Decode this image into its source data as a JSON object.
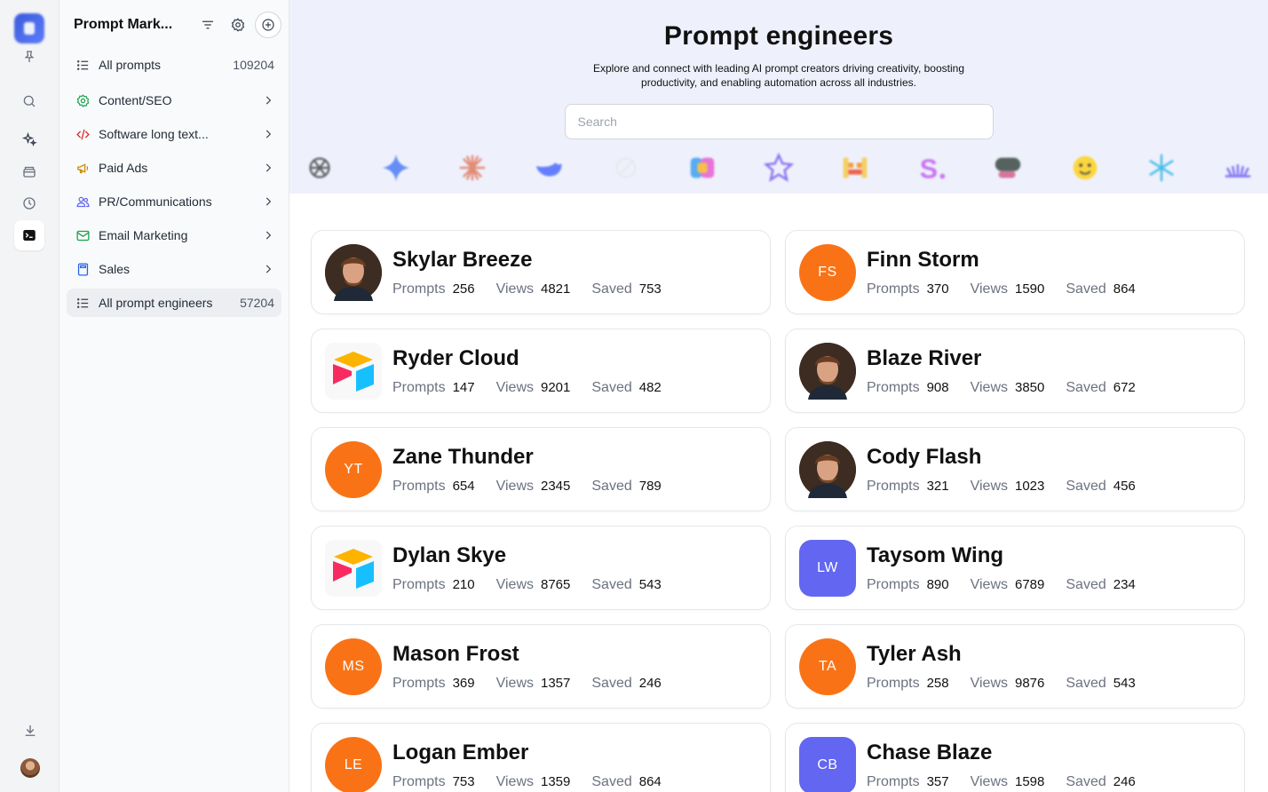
{
  "app": {
    "title": "Prompt Mark..."
  },
  "rail": {
    "icons": [
      "app-logo",
      "pin-icon",
      "search-icon",
      "sparkles-icon",
      "archive-icon",
      "history-icon",
      "terminal-icon",
      "download-icon",
      "user-avatar"
    ]
  },
  "sidebar": {
    "items": [
      {
        "label": "All prompts",
        "count": "109204",
        "icon": "list-icon"
      },
      {
        "label": "Content/SEO",
        "icon": "gear-icon"
      },
      {
        "label": "Software long text...",
        "icon": "code-icon"
      },
      {
        "label": "Paid Ads",
        "icon": "megaphone-icon"
      },
      {
        "label": "PR/Communications",
        "icon": "users-icon"
      },
      {
        "label": "Email Marketing",
        "icon": "mail-icon"
      },
      {
        "label": "Sales",
        "icon": "calculator-icon"
      },
      {
        "label": "All prompt engineers",
        "count": "57204",
        "icon": "list-icon"
      }
    ]
  },
  "hero": {
    "title": "Prompt engineers",
    "subtitle": "Explore and connect with leading AI prompt creators driving creativity, boosting productivity, and enabling automation across all industries.",
    "search_placeholder": "Search"
  },
  "stat_labels": {
    "prompts": "Prompts",
    "views": "Views",
    "saved": "Saved"
  },
  "engineers": [
    {
      "name": "Skylar Breeze",
      "initials": "",
      "avatar": "photo",
      "prompts": "256",
      "views": "4821",
      "saved": "753"
    },
    {
      "name": "Finn Storm",
      "initials": "FS",
      "avatar": "orange",
      "prompts": "370",
      "views": "1590",
      "saved": "864"
    },
    {
      "name": "Ryder Cloud",
      "initials": "",
      "avatar": "airtable",
      "prompts": "147",
      "views": "9201",
      "saved": "482"
    },
    {
      "name": "Blaze River",
      "initials": "",
      "avatar": "photo",
      "prompts": "908",
      "views": "3850",
      "saved": "672"
    },
    {
      "name": "Zane Thunder",
      "initials": "YT",
      "avatar": "orange",
      "prompts": "654",
      "views": "2345",
      "saved": "789"
    },
    {
      "name": "Cody Flash",
      "initials": "",
      "avatar": "photo",
      "prompts": "321",
      "views": "1023",
      "saved": "456"
    },
    {
      "name": "Dylan Skye",
      "initials": "",
      "avatar": "airtable",
      "prompts": "210",
      "views": "8765",
      "saved": "543"
    },
    {
      "name": "Taysom Wing",
      "initials": "LW",
      "avatar": "indigo",
      "prompts": "890",
      "views": "6789",
      "saved": "234"
    },
    {
      "name": "Mason Frost",
      "initials": "MS",
      "avatar": "orange",
      "prompts": "369",
      "views": "1357",
      "saved": "246"
    },
    {
      "name": "Tyler Ash",
      "initials": "TA",
      "avatar": "orange",
      "prompts": "258",
      "views": "9876",
      "saved": "543"
    },
    {
      "name": "Logan Ember",
      "initials": "LE",
      "avatar": "orange",
      "prompts": "753",
      "views": "1359",
      "saved": "864"
    },
    {
      "name": "Chase Blaze",
      "initials": "CB",
      "avatar": "indigo",
      "prompts": "357",
      "views": "1598",
      "saved": "246"
    }
  ],
  "colors": {
    "accent_orange": "#f97316",
    "accent_indigo": "#6366f1",
    "hero_bg": "#eef1fc"
  }
}
